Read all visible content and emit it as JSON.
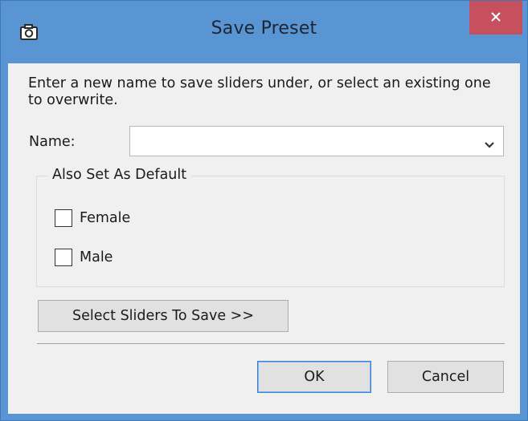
{
  "window": {
    "title": "Save Preset",
    "icons": {
      "app": "camera-icon",
      "close": "close-icon"
    },
    "colors": {
      "frame": "#5a95d3",
      "close_button": "#c7505f",
      "client": "#f0f0f0"
    }
  },
  "form": {
    "instructions": "Enter a new name to save sliders under, or select an existing one to overwrite.",
    "name_label": "Name:",
    "name_value": "",
    "name_dropdown_icon": "chevron-down-icon"
  },
  "default_group": {
    "legend": "Also Set As Default",
    "options": [
      {
        "label": "Female",
        "checked": false
      },
      {
        "label": "Male",
        "checked": false
      }
    ]
  },
  "buttons": {
    "select_sliders": "Select Sliders To Save >>",
    "ok": "OK",
    "cancel": "Cancel"
  }
}
